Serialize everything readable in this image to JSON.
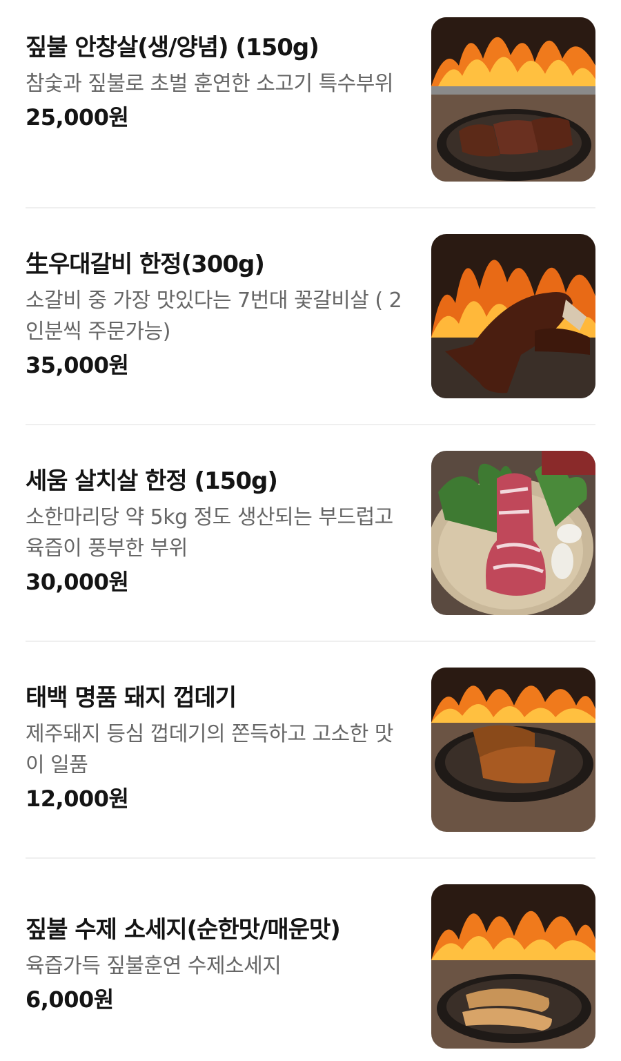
{
  "menu": {
    "items": [
      {
        "name": "짚불 안창살(생/양념) (150g)",
        "description": "참숯과 짚불로 초벌 훈연한 소고기 특수부위",
        "price": "25,000원",
        "image_icon": "grilled-beef-photo"
      },
      {
        "name": "生우대갈비 한정(300g)",
        "description": "소갈비 중 가장 맛있다는 7번대 꽃갈비살 ( 2인분씩 주문가능)",
        "price": "35,000원",
        "image_icon": "beef-rib-photo"
      },
      {
        "name": "세움 살치살 한정 (150g)",
        "description": "소한마리당 약 5kg 정도 생산되는 부드럽고 육즙이 풍부한 부위",
        "price": "30,000원",
        "image_icon": "raw-chuck-flap-photo"
      },
      {
        "name": "태백 명품 돼지 껍데기",
        "description": "제주돼지 등심 껍데기의 쫀득하고 고소한 맛이 일품",
        "price": "12,000원",
        "image_icon": "pork-skin-photo"
      },
      {
        "name": "짚불 수제 소세지(순한맛/매운맛)",
        "description": "육즙가득 짚불훈연 수제소세지",
        "price": "6,000원",
        "image_icon": "sausage-photo"
      }
    ]
  }
}
